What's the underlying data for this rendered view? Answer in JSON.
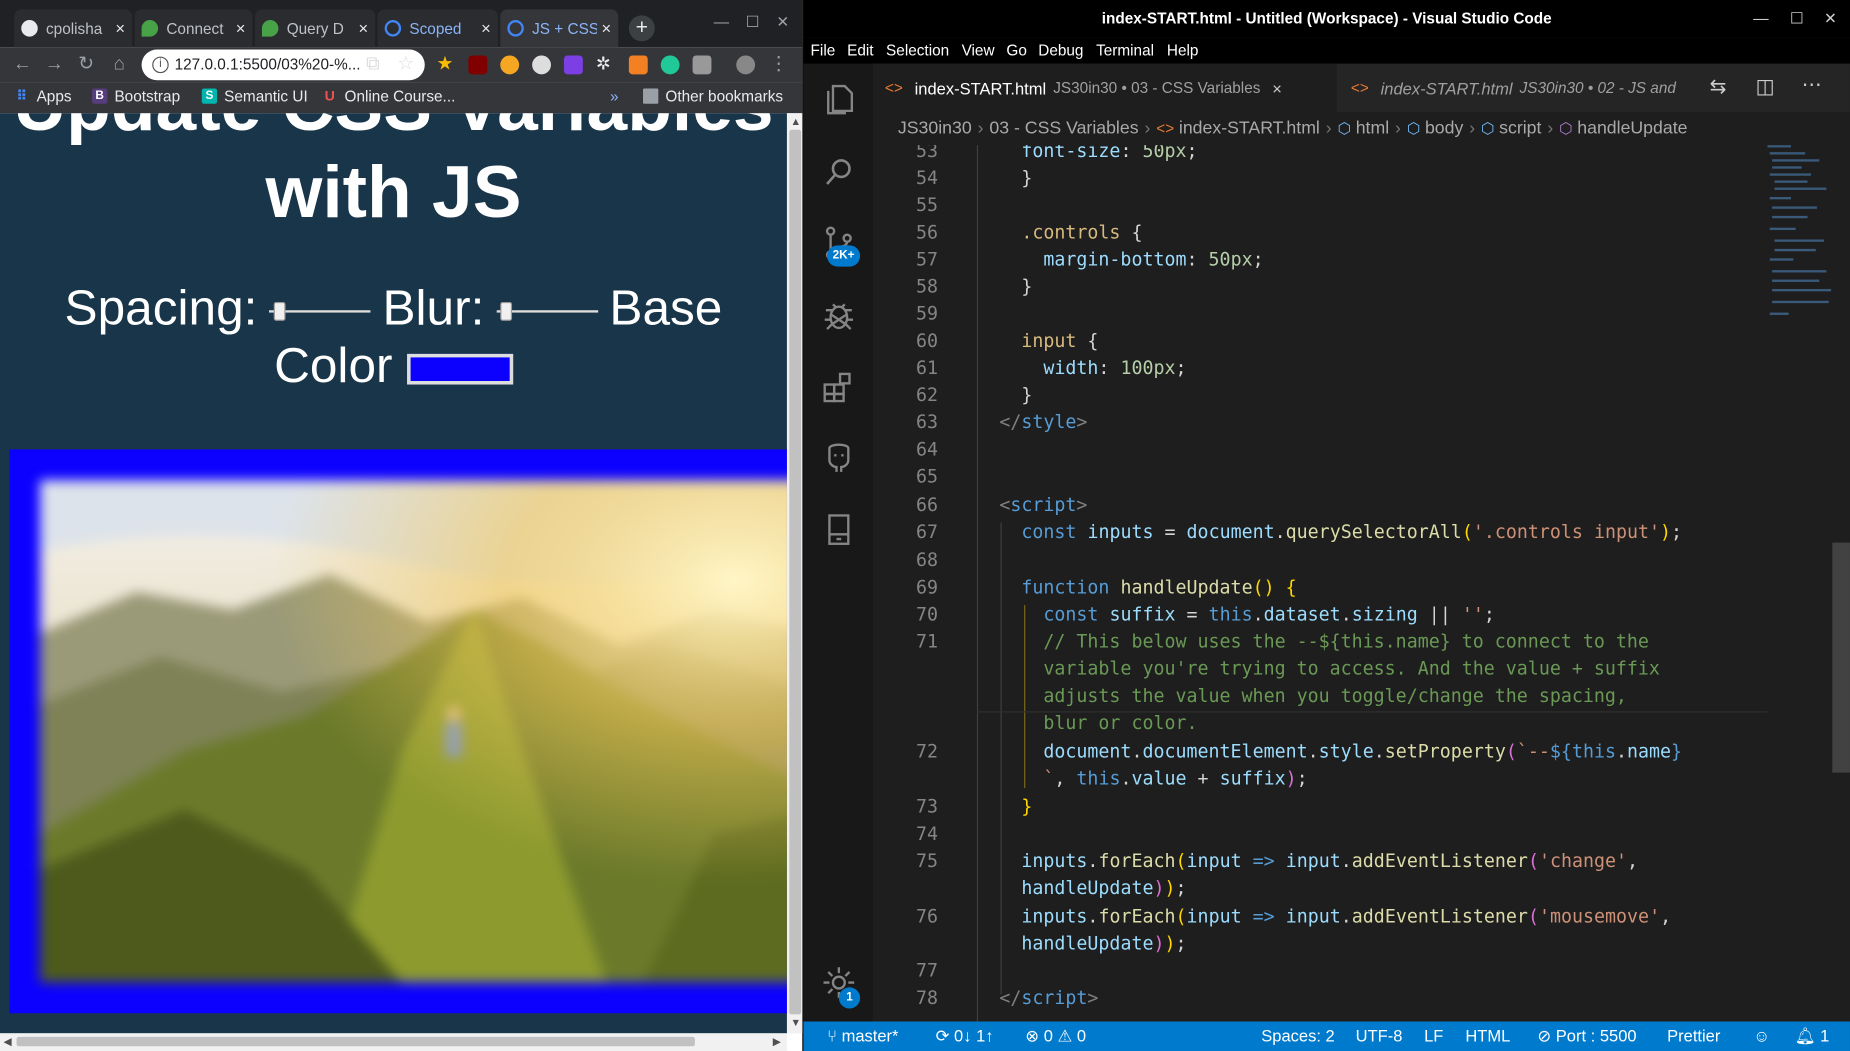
{
  "chrome": {
    "tabs": [
      {
        "title": "cpolisha",
        "color": "#e8eaed"
      },
      {
        "title": "Connect",
        "color": "#47a248"
      },
      {
        "title": "Query D",
        "color": "#47a248"
      },
      {
        "title": "Scoped",
        "color": "#4285f4"
      },
      {
        "title": "JS + CSS",
        "color": "#4285f4"
      }
    ],
    "new_tab": "+",
    "address": "127.0.0.1:5500/03%20-%...",
    "bookmarks": [
      {
        "label": "Apps",
        "icon": "apps-grid-icon",
        "color": "#4285f4"
      },
      {
        "label": "Bootstrap",
        "icon": "B",
        "color": "#563d7c"
      },
      {
        "label": "Semantic UI",
        "icon": "S",
        "color": "#00b5ad"
      },
      {
        "label": "Online Course...",
        "icon": "U",
        "color": "#ec5252"
      }
    ],
    "bookmarks_overflow": "»",
    "other_bookmarks": "Other bookmarks"
  },
  "page": {
    "heading": "Update CSS Variables with JS",
    "spacing_label": "Spacing:",
    "blur_label": "Blur:",
    "base_color_label": "Base Color",
    "spacing_value": 0.05,
    "blur_value": 0.05,
    "base_color": "#0c00ff",
    "background": "#193549"
  },
  "vscode": {
    "title": "index-START.html - Untitled (Workspace) - Visual Studio Code",
    "menu": [
      "File",
      "Edit",
      "Selection",
      "View",
      "Go",
      "Debug",
      "Terminal",
      "Help"
    ],
    "scm_badge": "2K+",
    "settings_badge": "1",
    "tabs": [
      {
        "name": "index-START.html",
        "desc": "JS30in30 • 03 - CSS Variables",
        "close": "×"
      },
      {
        "name": "index-START.html",
        "desc": "JS30in30 • 02 - JS and"
      }
    ],
    "breadcrumbs": [
      "JS30in30",
      "03 - CSS Variables",
      "index-START.html",
      "html",
      "body",
      "script",
      "handleUpdate"
    ],
    "line_numbers": [
      "53",
      "54",
      "55",
      "56",
      "57",
      "58",
      "59",
      "60",
      "61",
      "62",
      "63",
      "64",
      "65",
      "66",
      "67",
      "68",
      "69",
      "70",
      "71",
      "",
      "",
      "",
      "72",
      "",
      "73",
      "74",
      "75",
      "",
      "76",
      "",
      "77",
      "78"
    ],
    "status": {
      "branch": "master*",
      "sync": "0↓ 1↑",
      "errors": "0",
      "warnings": "0",
      "spaces": "Spaces: 2",
      "encoding": "UTF-8",
      "eol": "LF",
      "language": "HTML",
      "port": "Port : 5500",
      "prettier": "Prettier",
      "notifications": "1"
    }
  }
}
